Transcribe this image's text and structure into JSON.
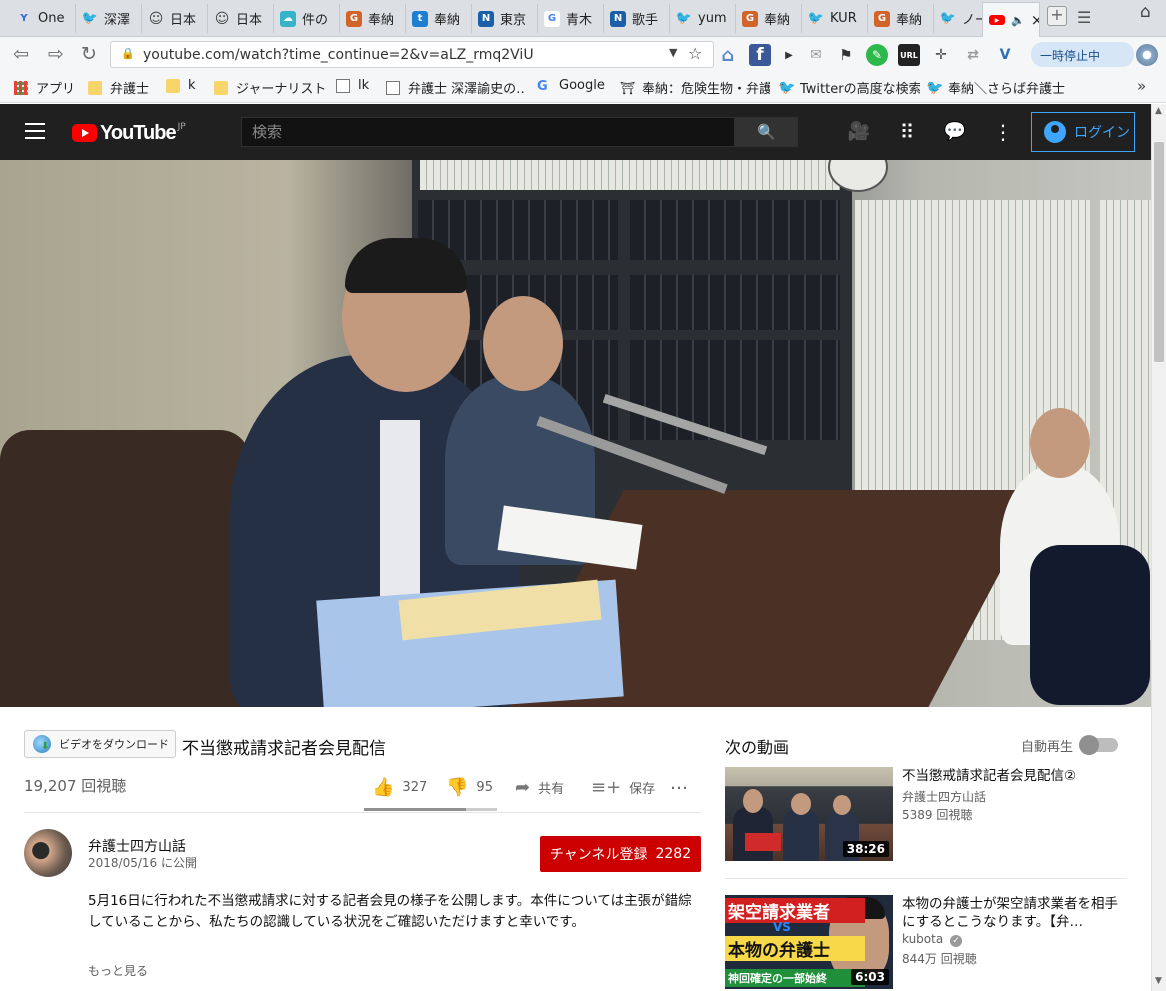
{
  "browser": {
    "tabs": [
      {
        "label": "One",
        "icon": "vivaldi-icon",
        "color": "#2e6cd1",
        "glyph": "Y"
      },
      {
        "label": "深澤",
        "icon": "twitter-icon",
        "color": "#1da1f2",
        "glyph": "🐦"
      },
      {
        "label": "日本",
        "icon": "hatena-icon",
        "color": "#444444",
        "glyph": "☺"
      },
      {
        "label": "日本",
        "icon": "hatena-icon",
        "color": "#444444",
        "glyph": "☺"
      },
      {
        "label": "件の",
        "icon": "cloud-icon",
        "color": "#36b3c9",
        "glyph": "☁"
      },
      {
        "label": "奉納",
        "icon": "shrine-icon",
        "color": "#d1642b",
        "glyph": "G"
      },
      {
        "label": "奉納",
        "icon": "blog-t-icon",
        "color": "#1d7fd1",
        "glyph": "t"
      },
      {
        "label": "東京",
        "icon": "news-icon",
        "color": "#1a5fa8",
        "glyph": "N"
      },
      {
        "label": "青木",
        "icon": "google-icon",
        "color": "#ffffff",
        "glyph": "G"
      },
      {
        "label": "歌手",
        "icon": "news-icon",
        "color": "#1a5fa8",
        "glyph": "N"
      },
      {
        "label": "yum",
        "icon": "twitter-icon",
        "color": "#1da1f2",
        "glyph": "🐦"
      },
      {
        "label": "奉納",
        "icon": "shrine-icon",
        "color": "#d1642b",
        "glyph": "G"
      },
      {
        "label": "KUR",
        "icon": "twitter-icon",
        "color": "#1da1f2",
        "glyph": "🐦"
      },
      {
        "label": "奉納",
        "icon": "shrine-icon",
        "color": "#d1642b",
        "glyph": "G"
      },
      {
        "label": "ノー",
        "icon": "twitter-icon",
        "color": "#1da1f2",
        "glyph": "🐦"
      }
    ],
    "active_tab": {
      "icon": "youtube-icon",
      "close": "×"
    },
    "new_tab": "+",
    "url": "youtube.com/watch?time_continue=2&v=aLZ_rmq2ViU",
    "pause_button": "一時停止中",
    "bookmarks": [
      {
        "label": "アプリ",
        "icon": "apps-grid-icon"
      },
      {
        "label": "弁護士",
        "icon": "folder-icon"
      },
      {
        "label": "k",
        "icon": "folder-icon"
      },
      {
        "label": "ジャーナリスト",
        "icon": "folder-icon"
      },
      {
        "label": "lk",
        "icon": "page-icon"
      },
      {
        "label": "弁護士 深澤諭史の…",
        "icon": "page-icon"
      },
      {
        "label": "Google",
        "icon": "google-icon"
      },
      {
        "label": "奉納：危険生物・弁護…",
        "icon": "shrine-icon"
      },
      {
        "label": "Twitterの高度な検索",
        "icon": "twitter-icon"
      },
      {
        "label": "奉納＼さらば弁護士…",
        "icon": "twitter-icon"
      }
    ],
    "bookmarks_more": "»"
  },
  "youtube": {
    "logo_text": "YouTube",
    "logo_region": "JP",
    "search_placeholder": "検索",
    "login_label": "ログイン"
  },
  "video": {
    "download_button": "ビデオをダウンロード",
    "title": "不当懲戒請求記者会見配信",
    "views": "19,207 回視聴",
    "likes": "327",
    "dislikes": "95",
    "like_ratio": 0.77,
    "share_label": "共有",
    "save_label": "保存",
    "more_actions": "…",
    "channel_name": "弁護士四方山話",
    "published": "2018/05/16 に公開",
    "subscribe_label": "チャンネル登録",
    "subscriber_count": "2282",
    "description": "5月16日に行われた不当懲戒請求に対する記者会見の様子を公開します。本件については主張が錯綜していることから、私たちの認識している状況をご確認いただけますと幸いです。",
    "show_more": "もっと見る"
  },
  "sidebar": {
    "heading": "次の動画",
    "autoplay_label": "自動再生",
    "autoplay_on": false,
    "items": [
      {
        "title": "不当懲戒請求記者会見配信②",
        "channel": "弁護士四方山話",
        "views": "5389 回視聴",
        "duration": "38:26",
        "verified": false
      },
      {
        "title": "本物の弁護士が架空請求業者を相手にするとこうなります。【弁…",
        "channel": "kubota",
        "views": "844万 回視聴",
        "duration": "6:03",
        "verified": true,
        "thumb_text_top": "架空請求業者",
        "thumb_text_vs": "VS",
        "thumb_text_mid": "本物の弁護士",
        "thumb_text_bottom": "神回確定の一部始終"
      }
    ]
  }
}
